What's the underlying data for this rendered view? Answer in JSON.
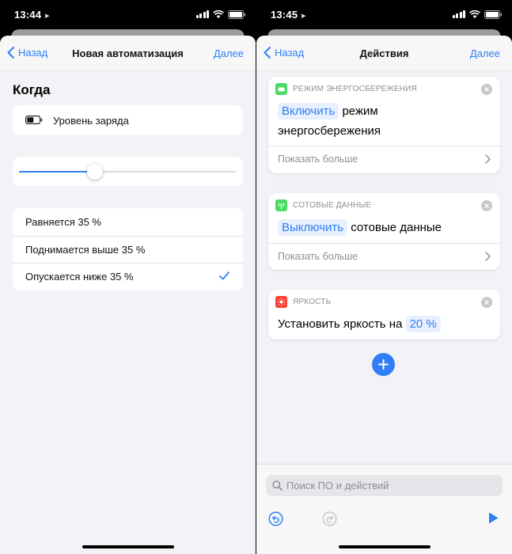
{
  "left": {
    "status": {
      "time": "13:44"
    },
    "nav": {
      "back": "Назад",
      "title": "Новая автоматизация",
      "next": "Далее"
    },
    "section_title": "Когда",
    "trigger_label": "Уровень заряда",
    "slider": {
      "value_percent": 35
    },
    "options": [
      {
        "label": "Равняется 35 %",
        "checked": false
      },
      {
        "label": "Поднимается выше 35 %",
        "checked": false
      },
      {
        "label": "Опускается ниже 35 %",
        "checked": true
      }
    ]
  },
  "right": {
    "status": {
      "time": "13:45"
    },
    "nav": {
      "back": "Назад",
      "title": "Действия",
      "next": "Далее"
    },
    "actions": [
      {
        "app": "РЕЖИМ ЭНЕРГОСБЕРЕЖЕНИЯ",
        "icon": "battery-icon",
        "icon_color": "#4cd964",
        "pill": "Включить",
        "text1": "режим",
        "text2": "энергосбережения",
        "more": "Показать больше"
      },
      {
        "app": "СОТОВЫЕ ДАННЫЕ",
        "icon": "antenna-icon",
        "icon_color": "#4cd964",
        "pill": "Выключить",
        "text1": "сотовые данные",
        "more": "Показать больше"
      },
      {
        "app": "ЯРКОСТЬ",
        "icon": "sun-icon",
        "icon_color": "#ff3b30",
        "text1": "Установить яркость на",
        "pill": "20 %"
      }
    ],
    "search_placeholder": "Поиск ПО и действий"
  },
  "colors": {
    "accent": "#2f7ef5",
    "background": "#f2f2f7"
  }
}
